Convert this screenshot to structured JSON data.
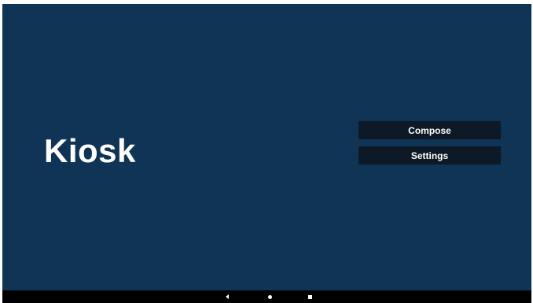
{
  "app": {
    "title": "Kiosk"
  },
  "menu": {
    "compose_label": "Compose",
    "settings_label": "Settings"
  },
  "navigation_bar": {
    "back_icon": "back-triangle-icon",
    "home_icon": "home-circle-icon",
    "recents_icon": "recents-square-icon"
  },
  "colors": {
    "background": "#0f3455",
    "button_background": "#0d1926",
    "text": "#ffffff",
    "nav_bar": "#000000"
  }
}
